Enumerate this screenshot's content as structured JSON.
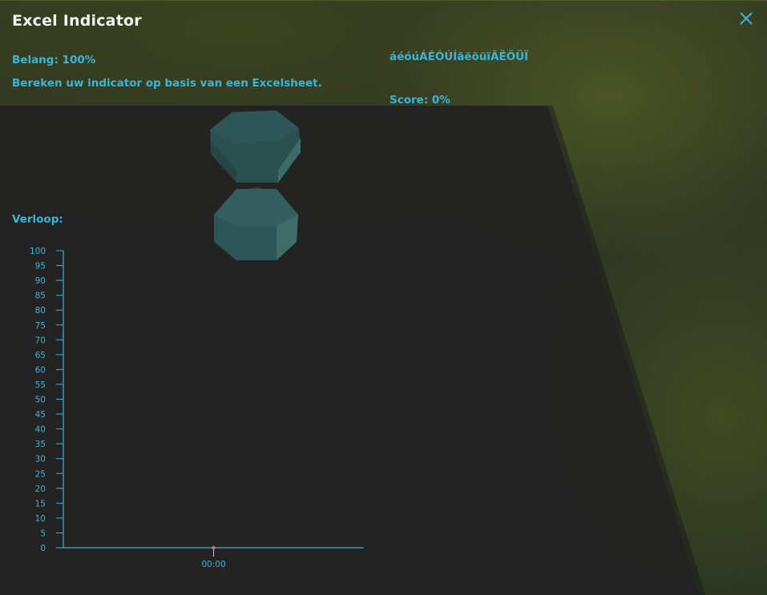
{
  "panel": {
    "title": "Excel Indicator",
    "importance": "Belang: 100%",
    "description": "Bereken uw indicator op basis van een Excelsheet.",
    "special_chars": "áéóúÁÉÓÚÍäëöüïÄËÖÜÏ",
    "score": "Score: 0%",
    "history_label": "Verloop:"
  },
  "icons": {
    "close": "close-icon",
    "loading": "hourglass-icon"
  },
  "colors": {
    "accent": "#39b5d8",
    "title": "#f2f2f2",
    "point": "#e07a5f"
  },
  "chart_data": {
    "type": "line",
    "title": "",
    "xlabel": "",
    "ylabel": "",
    "ylim": [
      0,
      100
    ],
    "yticks": [
      "0",
      "5",
      "10",
      "15",
      "20",
      "25",
      "30",
      "35",
      "40",
      "45",
      "50",
      "55",
      "60",
      "65",
      "70",
      "75",
      "80",
      "85",
      "90",
      "95",
      "100"
    ],
    "x": [
      "00:00"
    ],
    "series": [
      {
        "values": [
          0
        ]
      }
    ],
    "grid": false
  }
}
